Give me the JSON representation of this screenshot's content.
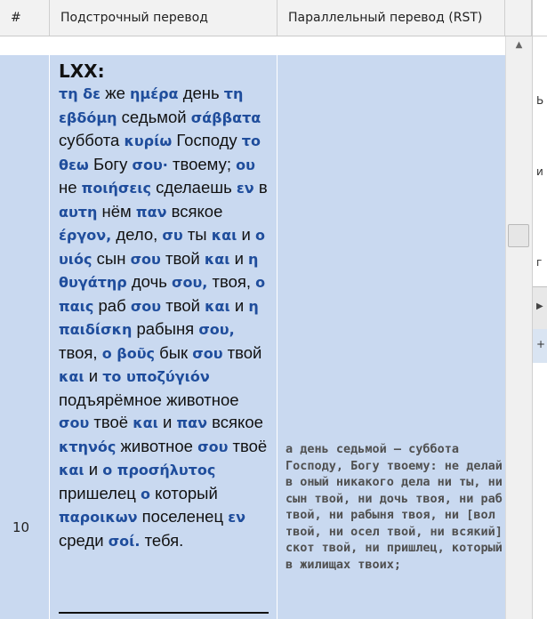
{
  "header": {
    "col_num": "#",
    "col_interlinear": "Подстрочный перевод",
    "col_parallel": "Параллельный перевод (RST)"
  },
  "row": {
    "number": "10",
    "source_label": "LXX:",
    "interlinear": [
      {
        "g": "τη δε",
        "r": "же"
      },
      {
        "g": "ημέρα",
        "r": "день"
      },
      {
        "g": "τη εβδόμη",
        "r": "седьмой"
      },
      {
        "g": "σάββατα",
        "r": "суббота"
      },
      {
        "g": "κυρίω",
        "r": "Господу"
      },
      {
        "g": "το θεω",
        "r": "Богу"
      },
      {
        "g": "σου·",
        "r": "твоему;"
      },
      {
        "g": "ου",
        "r": "не"
      },
      {
        "g": "ποιήσεις",
        "r": "сделаешь"
      },
      {
        "g": "εν",
        "r": "в"
      },
      {
        "g": "αυτη",
        "r": "нём"
      },
      {
        "g": "παν",
        "r": "всякое"
      },
      {
        "g": "έργον,",
        "r": "дело,"
      },
      {
        "g": "συ",
        "r": "ты"
      },
      {
        "g": "και",
        "r": "и"
      },
      {
        "g": "ο υιός",
        "r": "сын"
      },
      {
        "g": "σου",
        "r": "твой"
      },
      {
        "g": "και",
        "r": "и"
      },
      {
        "g": "η θυγάτηρ",
        "r": "дочь"
      },
      {
        "g": "σου,",
        "r": "твоя,"
      },
      {
        "g": "ο παις",
        "r": "раб"
      },
      {
        "g": "σου",
        "r": "твой"
      },
      {
        "g": "και",
        "r": "и"
      },
      {
        "g": "η παιδίσκη",
        "r": "рабыня"
      },
      {
        "g": "σου,",
        "r": "твоя,"
      },
      {
        "g": "ο βοῦς",
        "r": "бык"
      },
      {
        "g": "σου",
        "r": "твой"
      },
      {
        "g": "και",
        "r": "и"
      },
      {
        "g": "το υποζύγιόν",
        "r": "подъярёмное животное"
      },
      {
        "g": "σου",
        "r": "твоё"
      },
      {
        "g": "και",
        "r": "и"
      },
      {
        "g": "παν",
        "r": "всякое"
      },
      {
        "g": "κτηνός",
        "r": "животное"
      },
      {
        "g": "σου",
        "r": "твоё"
      },
      {
        "g": "και",
        "r": "и"
      },
      {
        "g": "ο προσήλυτος",
        "r": "пришелец"
      },
      {
        "g": "ο",
        "r": "который"
      },
      {
        "g": "παροικων",
        "r": "поселенец"
      },
      {
        "g": "εν",
        "r": "среди"
      },
      {
        "g": "σοί.",
        "r": "тебя."
      }
    ],
    "parallel_text": "а день седьмой — суббота Господу, Богу твоему: не делай в оный никакого дела ни ты, ни сын твой, ни дочь твоя, ни раб твой, ни рабыня твоя, ни [вол твой, ни осел твой, ни всякий] скот твой, ни пришлец, который в жилищах твоих;"
  },
  "side": {
    "marks": [
      "Ь",
      "и",
      "г",
      "+"
    ]
  },
  "colors": {
    "row_bg": "#c9d9f0",
    "greek": "#1f4d9c",
    "rst": "#505050"
  }
}
